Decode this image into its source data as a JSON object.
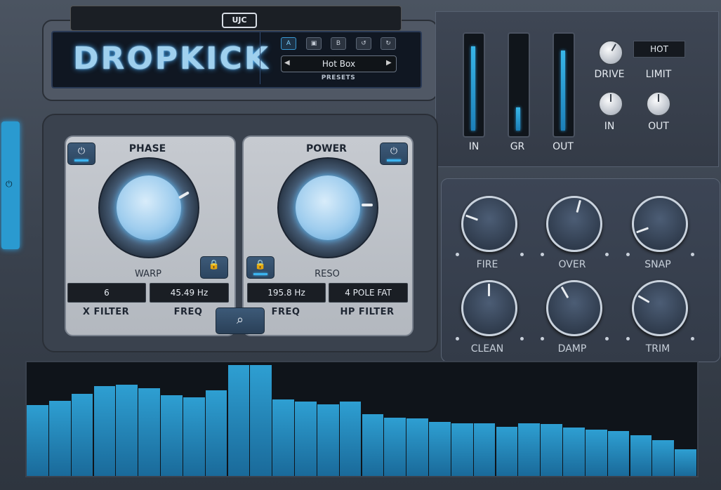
{
  "plugin": {
    "title": "DROPKICK",
    "brand": "UJC"
  },
  "presets": {
    "ab_buttons": [
      "A",
      "",
      "B",
      "",
      ""
    ],
    "current": "Hot Box",
    "label": "PRESETS"
  },
  "meters": [
    {
      "label": "IN",
      "level": 0.92
    },
    {
      "label": "GR",
      "level": 0.25
    },
    {
      "label": "OUT",
      "level": 0.88
    }
  ],
  "right_top": {
    "drive_label": "DRIVE",
    "limit_label": "LIMIT",
    "limit_mode": "HOT",
    "in_label": "IN",
    "out_label": "OUT"
  },
  "phase": {
    "title": "PHASE",
    "knob_label": "WARP"
  },
  "power": {
    "title": "POWER",
    "knob_label": "RESO"
  },
  "values": {
    "x_filter": "6",
    "freq1": "45.49 Hz",
    "freq2": "195.8 Hz",
    "hp_filter": "4 POLE FAT"
  },
  "value_labels": {
    "x_filter": "X FILTER",
    "freq1": "FREQ",
    "freq2": "FREQ",
    "hp_filter": "HP FILTER"
  },
  "knobs": [
    {
      "label": "FIRE",
      "angle": -70
    },
    {
      "label": "OVER",
      "angle": 15
    },
    {
      "label": "SNAP",
      "angle": -110
    },
    {
      "label": "CLEAN",
      "angle": 0
    },
    {
      "label": "DAMP",
      "angle": -30
    },
    {
      "label": "TRIM",
      "angle": -60
    }
  ],
  "colors": {
    "accent": "#2aa0e0",
    "bars": "#2e9fd2"
  },
  "chart_data": {
    "type": "bar",
    "values": [
      0.63,
      0.67,
      0.73,
      0.8,
      0.81,
      0.78,
      0.72,
      0.7,
      0.76,
      0.99,
      0.99,
      0.68,
      0.66,
      0.64,
      0.66,
      0.55,
      0.52,
      0.51,
      0.48,
      0.47,
      0.47,
      0.44,
      0.47,
      0.46,
      0.43,
      0.41,
      0.4,
      0.36,
      0.32,
      0.24
    ],
    "ylim": [
      0,
      1
    ]
  }
}
